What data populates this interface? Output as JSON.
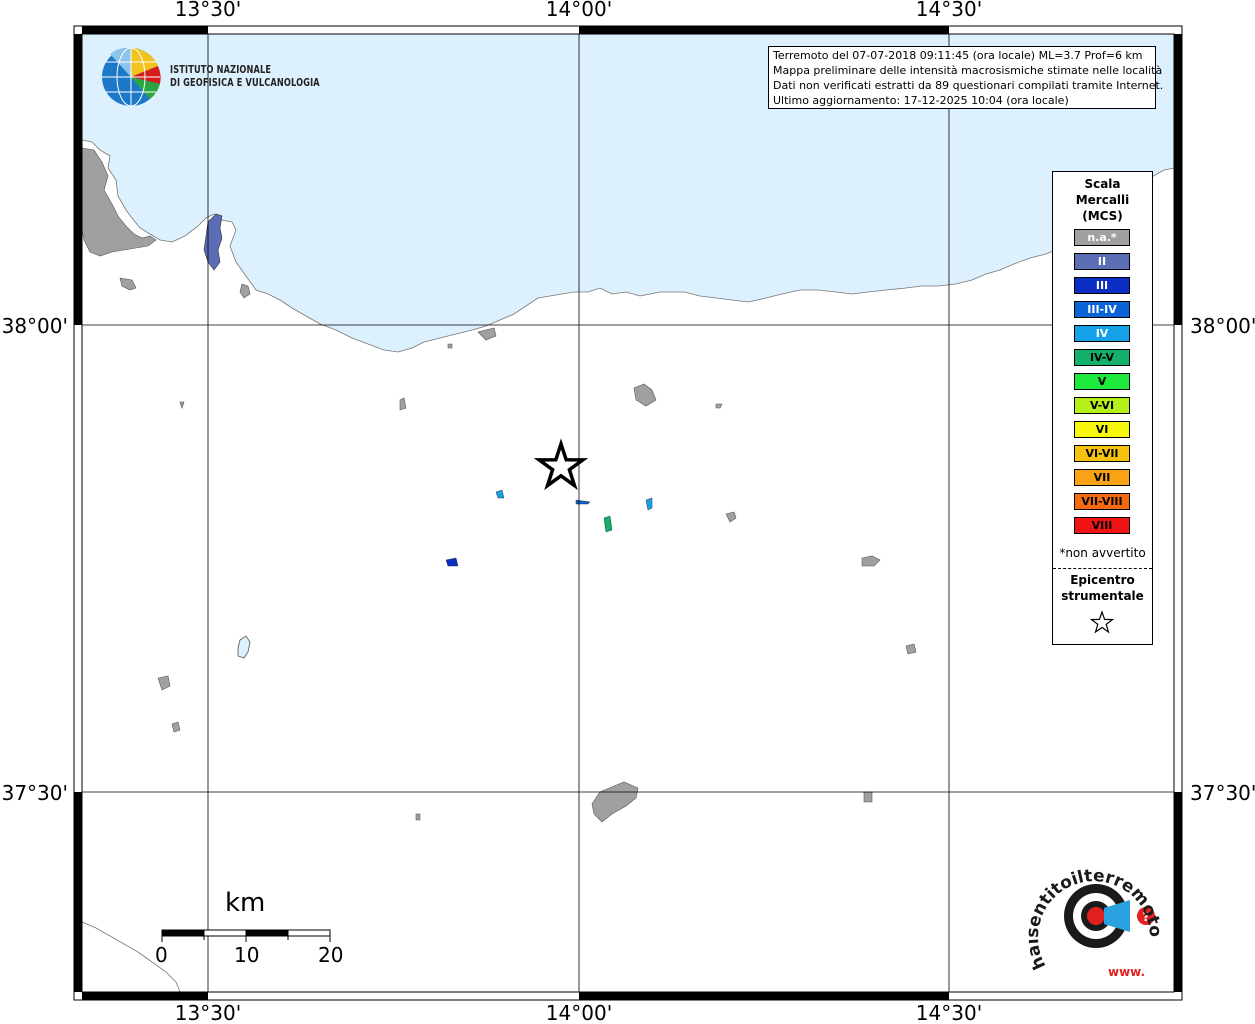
{
  "map": {
    "grid": {
      "lon_labels": [
        "13°30'",
        "14°00'",
        "14°30'"
      ],
      "lat_labels": [
        "38°00'",
        "37°30'"
      ]
    },
    "colors": {
      "sea": "#dcf0fd",
      "land": "#ffffff",
      "na_locality": "#a0a0a0",
      "frame": "#000000"
    }
  },
  "info": {
    "line1": "Terremoto del 07-07-2018 09:11:45 (ora locale) ML=3.7 Prof=6 km",
    "line2": "Mappa preliminare delle intensità macrosismiche stimate nelle località",
    "line3": "Dati non verificati estratti da 89 questionari compilati tramite Internet.",
    "line4": "Ultimo aggiornamento: 17-12-2025 10:04 (ora locale)"
  },
  "ingv": {
    "line1": "ISTITUTO NAZIONALE",
    "line2": "DI GEOFISICA E VULCANOLOGIA"
  },
  "legend": {
    "title1": "Scala",
    "title2": "Mercalli",
    "title3": "(MCS)",
    "items": [
      {
        "label": "n.a.*",
        "color": "#a0a0a0",
        "text_color": "#ffffff"
      },
      {
        "label": "II",
        "color": "#5b6db5",
        "text_color": "#ffffff"
      },
      {
        "label": "III",
        "color": "#0a2ec4",
        "text_color": "#ffffff"
      },
      {
        "label": "III-IV",
        "color": "#0a64d6",
        "text_color": "#ffffff"
      },
      {
        "label": "IV",
        "color": "#13a2e8",
        "text_color": "#ffffff"
      },
      {
        "label": "IV-V",
        "color": "#12b06a",
        "text_color": "#000000"
      },
      {
        "label": "V",
        "color": "#1ee83c",
        "text_color": "#000000"
      },
      {
        "label": "V-VI",
        "color": "#b6f01a",
        "text_color": "#000000"
      },
      {
        "label": "VI",
        "color": "#f8f80e",
        "text_color": "#000000"
      },
      {
        "label": "VI-VII",
        "color": "#f6c20e",
        "text_color": "#000000"
      },
      {
        "label": "VII",
        "color": "#f8a214",
        "text_color": "#000000"
      },
      {
        "label": "VII-VIII",
        "color": "#f56a10",
        "text_color": "#000000"
      },
      {
        "label": "VIII",
        "color": "#f21414",
        "text_color": "#000000"
      }
    ],
    "note": "*non avvertito",
    "epicenter1": "Epicentro",
    "epicenter2": "strumentale"
  },
  "scale": {
    "unit": "km",
    "labels": [
      "0",
      "10",
      "20"
    ]
  },
  "hse": {
    "text": "haisentitoilterremoto.it",
    "www": "www."
  }
}
